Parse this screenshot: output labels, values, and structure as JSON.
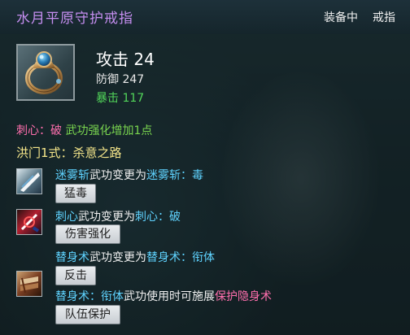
{
  "tooltip": {
    "item_name": "水月平原守护戒指",
    "equip_status": "装备中",
    "equip_slot": "戒指",
    "icon": "ring-icon",
    "stats": {
      "attack": "攻击 24",
      "defense": "防御 247",
      "crit": "暴击 117"
    },
    "bonus_line": {
      "prefix": "刺心：破",
      "text": "武功强化增加1点"
    },
    "style_line": {
      "label": "洪门1式：",
      "name": "杀意之路"
    },
    "skills": [
      {
        "icon": "mist-slash-skill-icon",
        "parts": [
          "迷雾斩",
          "武功变更为",
          "迷雾斩：毒"
        ],
        "button": "猛毒"
      },
      {
        "icon": "heart-pierce-skill-icon",
        "parts": [
          "刺心",
          "武功变更为",
          "刺心：破"
        ],
        "button": "伤害强化"
      },
      {
        "icon": "substitute-skill-icon",
        "parts": [
          "替身术",
          "武功变更为",
          "替身术：衔体"
        ],
        "button": "反击"
      }
    ],
    "extra_line": {
      "parts": [
        "替身术：衔体",
        "武功使用时可施展",
        "保护隐身术"
      ],
      "button": "队伍保护"
    }
  },
  "colors": {
    "item_name": "#c58ef0",
    "skill_name": "#5fd3ff",
    "bonus": "#ff6fae",
    "crit": "#52d65a"
  }
}
